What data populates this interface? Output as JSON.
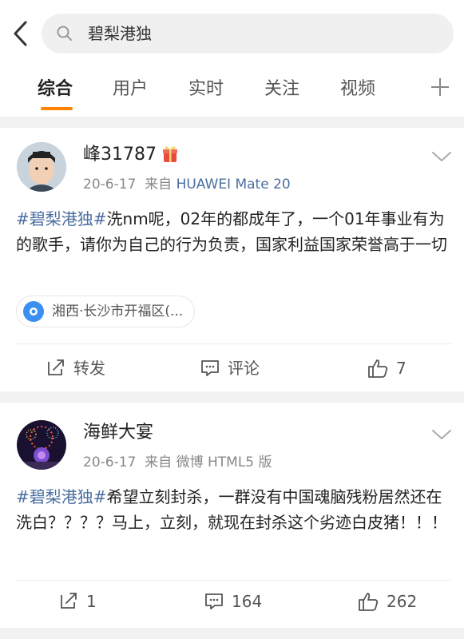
{
  "search": {
    "query": "碧梨港独"
  },
  "tabs": [
    "综合",
    "用户",
    "实时",
    "关注",
    "视频"
  ],
  "posts": [
    {
      "username": "峰31787",
      "date": "20-6-17",
      "source_prefix": "来自",
      "device": "HUAWEI Mate 20",
      "topic": "#碧梨港独#",
      "text": "洗nm呢，02年的都成年了，一个01年事业有为的歌手，请你为自己的行为负责，国家利益国家荣誉高于一切",
      "location": "湘西·长沙市开福区(...",
      "actions": {
        "repost": "转发",
        "comment": "评论",
        "likes": "7"
      }
    },
    {
      "username": "海鲜大宴",
      "date": "20-6-17",
      "source_prefix": "来自",
      "device": "微博 HTML5 版",
      "topic": "#碧梨港独#",
      "text": "希望立刻封杀，一群没有中国魂脑残粉居然还在洗白？？？？马上，立刻，就现在封杀这个劣迹白皮猪！！！",
      "actions": {
        "repost": "1",
        "comment": "164",
        "likes": "262"
      }
    }
  ],
  "colors": {
    "accent": "#ff8200",
    "link": "#4a6ea0",
    "gap": "#f2f2f2"
  }
}
